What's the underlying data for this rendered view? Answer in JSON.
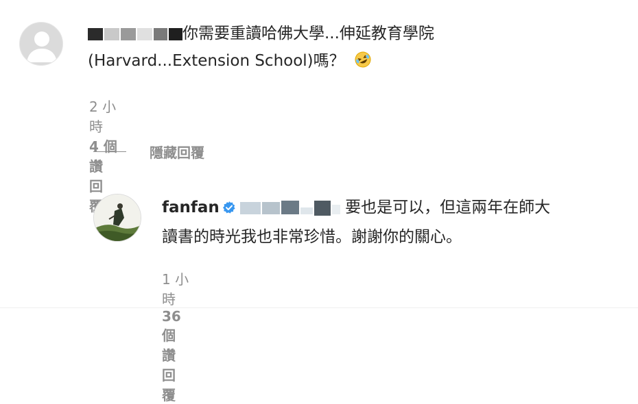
{
  "comment1": {
    "text_line1": "你需要重讀哈佛大學...伸延教育學院",
    "text_line2": "(Harvard...Extension School)嗎？",
    "emoji_icon": "rolling-on-floor-laughing-emoji",
    "meta": {
      "time": "2 小時",
      "likes": "4 個讚",
      "reply": "回覆"
    }
  },
  "hide_replies": {
    "label": "隱藏回覆"
  },
  "reply": {
    "username": "fanfan",
    "verified_icon": "verified-badge-icon",
    "text_line1": "要也是可以，但這兩年在師大",
    "text_line2": "讀書的時光我也非常珍惜。謝謝你的關心。",
    "meta": {
      "time": "1 小時",
      "likes": "36 個讚",
      "reply": "回覆"
    }
  },
  "colors": {
    "text": "#262626",
    "meta": "#8e8e8e",
    "verified": "#3897f0",
    "avatar_placeholder": "#dbdbdb"
  }
}
